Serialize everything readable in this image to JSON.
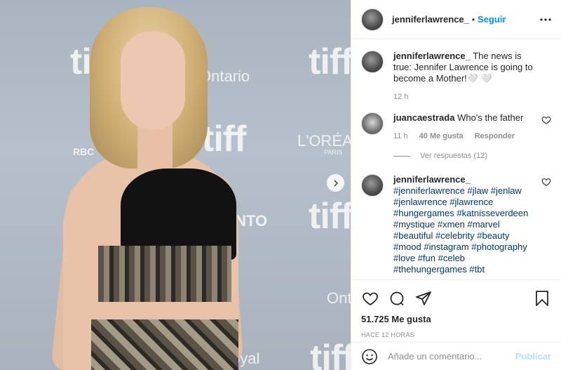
{
  "photo": {
    "description_icon": "next-arrow-icon",
    "watermarks": [
      "tiff",
      "tiff",
      "tiff",
      "tiff",
      "tiff",
      "Ontario",
      "L'ORÉAL",
      "PARIS",
      "RBC",
      "ONTO",
      "oyal",
      "Ont"
    ]
  },
  "header": {
    "username": "jenniferlawrence_",
    "separator": "•",
    "follow_label": "Seguir",
    "more_icon": "more-horizontal-icon"
  },
  "comments": [
    {
      "username": "jenniferlawrence_",
      "text": "The news is true: Jennifer Lawrence is going to become a Mother!🤍 🤍",
      "time": "12 h"
    },
    {
      "username": "juancaestrada",
      "text": "Who's the father",
      "time": "11 h",
      "likes": "40 Me gusta",
      "reply_label": "Responder",
      "view_replies": "Ver respuestas (12)"
    },
    {
      "username": "jenniferlawrence_",
      "tags": "#jenniferlawrence #jlaw #jenlaw #jenlawrence #jlawrence #hungergames #katnisseverdeen #mystique #xmen #marvel #beautiful #celebrity #beauty #mood #instagram #photography #love #fun #celeb #thehungergames #tbt"
    }
  ],
  "actions": {
    "icons": [
      "heart-icon",
      "comment-icon",
      "share-icon",
      "bookmark-icon"
    ],
    "likes": "51.725 Me gusta",
    "time": "HACE 12 HORAS"
  },
  "add_comment": {
    "placeholder": "Añade un comentario...",
    "publish_label": "Publicar"
  },
  "colors": {
    "link": "#00376b",
    "accent": "#0095f6",
    "publish_disabled": "#b2dffc",
    "muted": "#8e8e8e"
  }
}
